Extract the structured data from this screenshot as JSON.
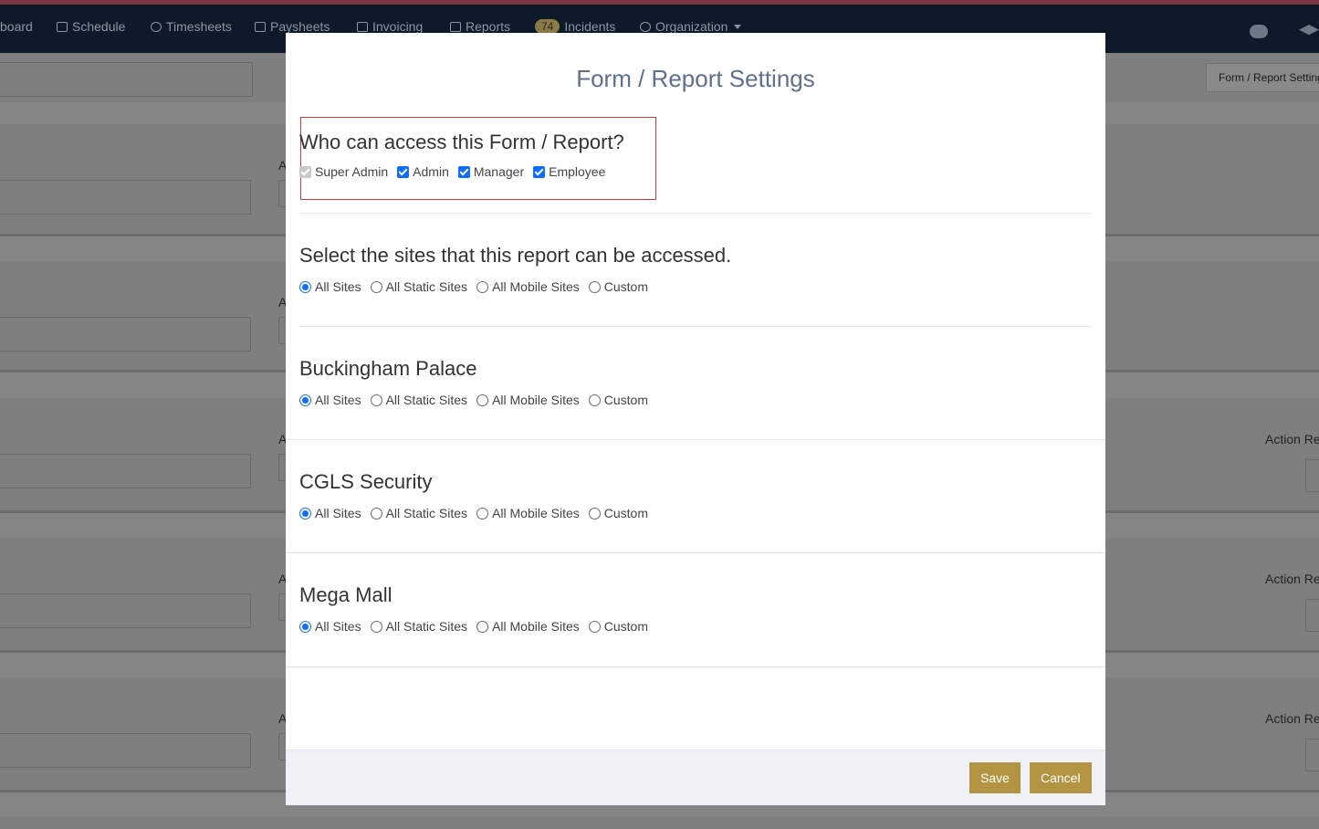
{
  "nav": {
    "items": [
      {
        "label": "board"
      },
      {
        "label": "Schedule"
      },
      {
        "label": "Timesheets"
      },
      {
        "label": "Paysheets"
      },
      {
        "label": "Invoicing"
      },
      {
        "label": "Reports"
      },
      {
        "label": "Incidents",
        "badge": "74"
      },
      {
        "label": "Organization"
      }
    ]
  },
  "background": {
    "breadcrumb": "Form / Report Settings",
    "action_label": "Action Re",
    "field_label": "A"
  },
  "modal": {
    "title": "Form / Report Settings",
    "access": {
      "heading": "Who can access this Form / Report?",
      "roles": [
        {
          "label": "Super Admin",
          "checked": true,
          "disabled": true
        },
        {
          "label": "Admin",
          "checked": true
        },
        {
          "label": "Manager",
          "checked": true
        },
        {
          "label": "Employee",
          "checked": true
        }
      ]
    },
    "site_options": [
      "All Sites",
      "All Static Sites",
      "All Mobile Sites",
      "Custom"
    ],
    "sections": [
      {
        "heading": "Select the sites that this report can be accessed.",
        "selected": "All Sites"
      },
      {
        "heading": "Buckingham Palace",
        "selected": "All Sites"
      },
      {
        "heading": "CGLS Security",
        "selected": "All Sites"
      },
      {
        "heading": "Mega Mall",
        "selected": "All Sites"
      }
    ],
    "buttons": {
      "save": "Save",
      "cancel": "Cancel"
    }
  }
}
